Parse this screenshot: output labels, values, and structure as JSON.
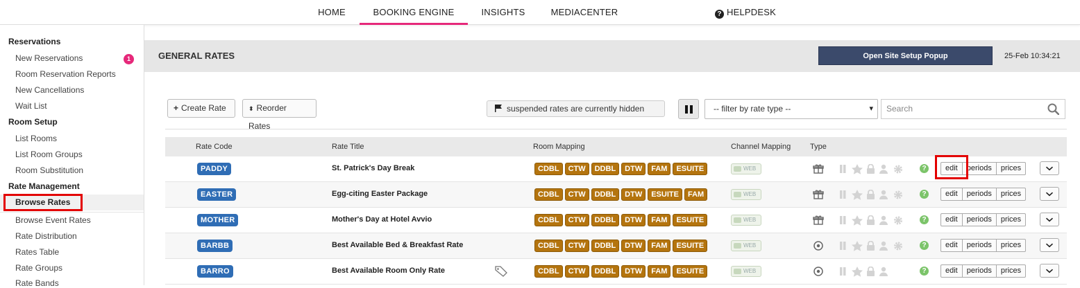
{
  "nav": {
    "items": [
      "HOME",
      "BOOKING ENGINE",
      "INSIGHTS",
      "MEDIACENTER"
    ],
    "active": "BOOKING ENGINE",
    "helpdesk": "HELPDESK"
  },
  "sidebar": {
    "sections": [
      {
        "title": "Reservations",
        "items": [
          "New Reservations",
          "Room Reservation Reports",
          "New Cancellations",
          "Wait List"
        ]
      },
      {
        "title": "Room Setup",
        "items": [
          "List Rooms",
          "List Room Groups",
          "Room Substitution"
        ]
      },
      {
        "title": "Rate Management",
        "items": [
          "Browse Rates",
          "Browse Event Rates",
          "Rate Distribution",
          "Rates Table",
          "Rate Groups",
          "Rate Bands"
        ]
      }
    ],
    "badge": "1",
    "active": "Browse Rates"
  },
  "header": {
    "title": "GENERAL RATES",
    "popup_button": "Open Site Setup Popup",
    "clock": "25-Feb 10:34:21"
  },
  "toolbar": {
    "create": "Create Rate",
    "reorder": "Reorder Rates",
    "suspended": "suspended rates are currently hidden",
    "filter": "-- filter by rate type --",
    "search_placeholder": "Search"
  },
  "table": {
    "headers": [
      "Rate Code",
      "Rate Title",
      "Room Mapping",
      "Channel Mapping",
      "Type"
    ],
    "rows": [
      {
        "code": "PADDY",
        "title": "St. Patrick's Day Break",
        "rooms": [
          "CDBL",
          "CTW",
          "DDBL",
          "DTW",
          "FAM",
          "ESUITE"
        ],
        "channel": "WEB",
        "type": "package",
        "tag": false
      },
      {
        "code": "EASTER",
        "title": "Egg-citing Easter Package",
        "rooms": [
          "CDBL",
          "CTW",
          "DDBL",
          "DTW",
          "ESUITE",
          "FAM"
        ],
        "channel": "WEB",
        "type": "package",
        "tag": false
      },
      {
        "code": "MOTHER",
        "title": "Mother's Day at Hotel Avvio",
        "rooms": [
          "CDBL",
          "CTW",
          "DDBL",
          "DTW",
          "FAM",
          "ESUITE"
        ],
        "channel": "WEB",
        "type": "package",
        "tag": false
      },
      {
        "code": "BARBB",
        "title": "Best Available Bed & Breakfast Rate",
        "rooms": [
          "CDBL",
          "CTW",
          "DDBL",
          "DTW",
          "FAM",
          "ESUITE"
        ],
        "channel": "WEB",
        "type": "standard",
        "tag": false
      },
      {
        "code": "BARRO",
        "title": "Best Available Room Only Rate",
        "rooms": [
          "CDBL",
          "CTW",
          "DDBL",
          "DTW",
          "FAM",
          "ESUITE"
        ],
        "channel": "WEB",
        "type": "standard",
        "tag": true
      }
    ],
    "actions": [
      "edit",
      "periods",
      "prices"
    ]
  }
}
